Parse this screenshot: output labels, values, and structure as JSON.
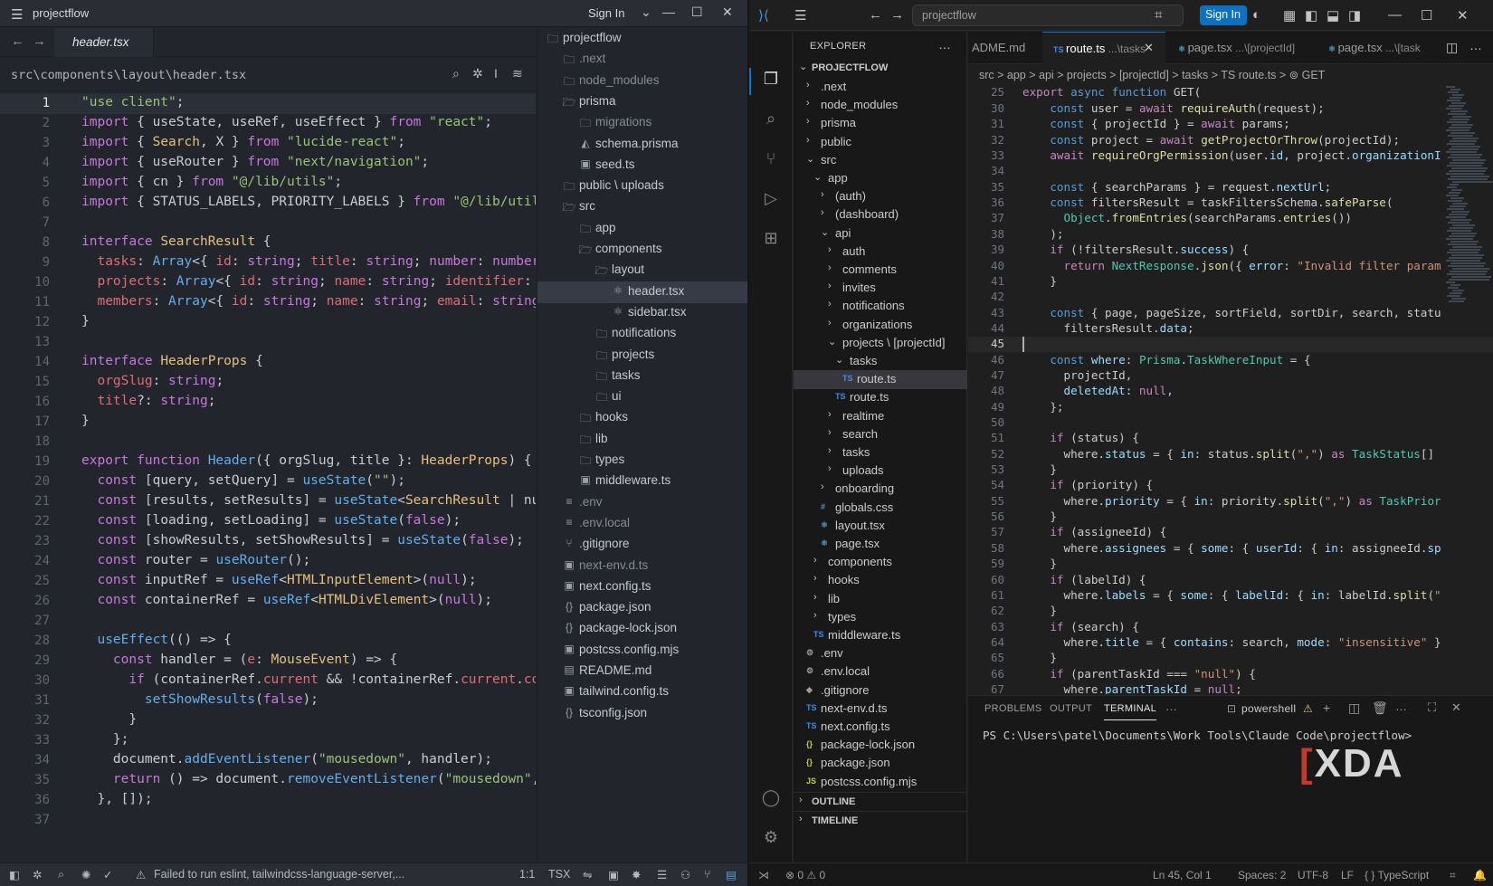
{
  "left": {
    "title": {
      "menu_icon": "hamburger-icon",
      "project": "projectflow",
      "sign_in": "Sign In"
    },
    "tab": {
      "label": "header.tsx"
    },
    "breadcrumb": "src\\components\\layout\\header.tsx",
    "status": {
      "message": "Failed to run eslint, tailwindcss-language-server,...",
      "position": "1:1",
      "language": "TSX"
    },
    "code_lines": [
      "\"use client\";",
      "import { useState, useRef, useEffect } from \"react\";",
      "import { Search, X } from \"lucide-react\";",
      "import { useRouter } from \"next/navigation\";",
      "import { cn } from \"@/lib/utils\";",
      "import { STATUS_LABELS, PRIORITY_LABELS } from \"@/lib/util",
      "",
      "interface SearchResult {",
      "  tasks: Array<{ id: string; title: string; number: number",
      "  projects: Array<{ id: string; name: string; identifier:",
      "  members: Array<{ id: string; name: string; email: string",
      "}",
      "",
      "interface HeaderProps {",
      "  orgSlug: string;",
      "  title?: string;",
      "}",
      "",
      "export function Header({ orgSlug, title }: HeaderProps) {",
      "  const [query, setQuery] = useState(\"\");",
      "  const [results, setResults] = useState<SearchResult | nu",
      "  const [loading, setLoading] = useState(false);",
      "  const [showResults, setShowResults] = useState(false);",
      "  const router = useRouter();",
      "  const inputRef = useRef<HTMLInputElement>(null);",
      "  const containerRef = useRef<HTMLDivElement>(null);",
      "",
      "  useEffect(() => {",
      "    const handler = (e: MouseEvent) => {",
      "      if (containerRef.current && !containerRef.current.co",
      "        setShowResults(false);",
      "      }",
      "    };",
      "    document.addEventListener(\"mousedown\", handler);",
      "    return () => document.removeEventListener(\"mousedown\",",
      "  }, []);",
      ""
    ],
    "tree": [
      {
        "name": "projectflow",
        "type": "folder"
      },
      {
        "name": ".next",
        "type": "folder",
        "dim": true
      },
      {
        "name": "node_modules",
        "type": "folder",
        "dim": true
      },
      {
        "name": "prisma",
        "type": "folder-open"
      },
      {
        "name": "migrations",
        "type": "folder",
        "dim": true
      },
      {
        "name": "schema.prisma",
        "type": "prisma"
      },
      {
        "name": "seed.ts",
        "type": "ts"
      },
      {
        "name": "public \\ uploads",
        "type": "folder"
      },
      {
        "name": "src",
        "type": "folder-open"
      },
      {
        "name": "app",
        "type": "folder"
      },
      {
        "name": "components",
        "type": "folder-open"
      },
      {
        "name": "layout",
        "type": "folder-open"
      },
      {
        "name": "header.tsx",
        "type": "react",
        "selected": true
      },
      {
        "name": "sidebar.tsx",
        "type": "react"
      },
      {
        "name": "notifications",
        "type": "folder"
      },
      {
        "name": "projects",
        "type": "folder"
      },
      {
        "name": "tasks",
        "type": "folder"
      },
      {
        "name": "ui",
        "type": "folder"
      },
      {
        "name": "hooks",
        "type": "folder"
      },
      {
        "name": "lib",
        "type": "folder"
      },
      {
        "name": "types",
        "type": "folder"
      },
      {
        "name": "middleware.ts",
        "type": "ts"
      },
      {
        "name": ".env",
        "type": "env",
        "dim": true
      },
      {
        "name": ".env.local",
        "type": "env",
        "dim": true
      },
      {
        "name": ".gitignore",
        "type": "git"
      },
      {
        "name": "next-env.d.ts",
        "type": "ts",
        "dim": true
      },
      {
        "name": "next.config.ts",
        "type": "ts"
      },
      {
        "name": "package.json",
        "type": "json"
      },
      {
        "name": "package-lock.json",
        "type": "json"
      },
      {
        "name": "postcss.config.mjs",
        "type": "js"
      },
      {
        "name": "README.md",
        "type": "md"
      },
      {
        "name": "tailwind.config.ts",
        "type": "ts"
      },
      {
        "name": "tsconfig.json",
        "type": "json"
      }
    ]
  },
  "right": {
    "title": {
      "search": "projectflow",
      "sign_in": "Sign In"
    },
    "explorer": {
      "header": "EXPLORER",
      "root": "PROJECTFLOW",
      "outline": "OUTLINE",
      "timeline": "TIMELINE"
    },
    "tabs": [
      {
        "label": "ADME.md",
        "dir": ""
      },
      {
        "label": "route.ts",
        "dir": " ...\\tasks",
        "active": true
      },
      {
        "label": "page.tsx",
        "dir": " ...\\[projectId]"
      },
      {
        "label": "page.tsx",
        "dir": " ...\\[task"
      }
    ],
    "breadcrumb": "src > app > api > projects > [projectId] > tasks > TS route.ts > ⊚ GET",
    "tree": [
      {
        "name": ".next",
        "depth": 0,
        "chev": "›"
      },
      {
        "name": "node_modules",
        "depth": 0,
        "chev": "›"
      },
      {
        "name": "prisma",
        "depth": 0,
        "chev": "›"
      },
      {
        "name": "public",
        "depth": 0,
        "chev": "›"
      },
      {
        "name": "src",
        "depth": 0,
        "chev": "⌄"
      },
      {
        "name": "app",
        "depth": 1,
        "chev": "⌄"
      },
      {
        "name": "(auth)",
        "depth": 2,
        "chev": "›"
      },
      {
        "name": "(dashboard)",
        "depth": 2,
        "chev": "›"
      },
      {
        "name": "api",
        "depth": 2,
        "chev": "⌄"
      },
      {
        "name": "auth",
        "depth": 3,
        "chev": "›"
      },
      {
        "name": "comments",
        "depth": 3,
        "chev": "›"
      },
      {
        "name": "invites",
        "depth": 3,
        "chev": "›"
      },
      {
        "name": "notifications",
        "depth": 3,
        "chev": "›"
      },
      {
        "name": "organizations",
        "depth": 3,
        "chev": "›"
      },
      {
        "name": "projects \\ [projectId]",
        "depth": 3,
        "chev": "⌄"
      },
      {
        "name": "tasks",
        "depth": 4,
        "chev": "⌄"
      },
      {
        "name": "route.ts",
        "depth": 5,
        "file": "TS",
        "selected": true
      },
      {
        "name": "route.ts",
        "depth": 4,
        "file": "TS"
      },
      {
        "name": "realtime",
        "depth": 3,
        "chev": "›"
      },
      {
        "name": "search",
        "depth": 3,
        "chev": "›"
      },
      {
        "name": "tasks",
        "depth": 3,
        "chev": "›"
      },
      {
        "name": "uploads",
        "depth": 3,
        "chev": "›"
      },
      {
        "name": "onboarding",
        "depth": 2,
        "chev": "›"
      },
      {
        "name": "globals.css",
        "depth": 2,
        "file": "#"
      },
      {
        "name": "layout.tsx",
        "depth": 2,
        "file": "⚛"
      },
      {
        "name": "page.tsx",
        "depth": 2,
        "file": "⚛"
      },
      {
        "name": "components",
        "depth": 1,
        "chev": "›"
      },
      {
        "name": "hooks",
        "depth": 1,
        "chev": "›"
      },
      {
        "name": "lib",
        "depth": 1,
        "chev": "›"
      },
      {
        "name": "types",
        "depth": 1,
        "chev": "›"
      },
      {
        "name": "middleware.ts",
        "depth": 1,
        "file": "TS"
      },
      {
        "name": ".env",
        "depth": 0,
        "file": "⚙"
      },
      {
        "name": ".env.local",
        "depth": 0,
        "file": "⚙"
      },
      {
        "name": ".gitignore",
        "depth": 0,
        "file": "◆"
      },
      {
        "name": "next-env.d.ts",
        "depth": 0,
        "file": "TS"
      },
      {
        "name": "next.config.ts",
        "depth": 0,
        "file": "TS"
      },
      {
        "name": "package-lock.json",
        "depth": 0,
        "file": "{}"
      },
      {
        "name": "package.json",
        "depth": 0,
        "file": "{}"
      },
      {
        "name": "postcss.config.mjs",
        "depth": 0,
        "file": "JS"
      }
    ],
    "code_start": 25,
    "code_lines": [
      "export async function GET(",
      "    const user = await requireAuth(request);",
      "    const { projectId } = await params;",
      "    const project = await getProjectOrThrow(projectId);",
      "    await requireOrgPermission(user.id, project.organizationI",
      "",
      "    const { searchParams } = request.nextUrl;",
      "    const filtersResult = taskFiltersSchema.safeParse(",
      "      Object.fromEntries(searchParams.entries())",
      "    );",
      "    if (!filtersResult.success) {",
      "      return NextResponse.json({ error: \"Invalid filter param",
      "    }",
      "",
      "    const { page, pageSize, sortField, sortDir, search, statu",
      "      filtersResult.data;",
      "",
      "    const where: Prisma.TaskWhereInput = {",
      "      projectId,",
      "      deletedAt: null,",
      "    };",
      "",
      "    if (status) {",
      "      where.status = { in: status.split(\",\") as TaskStatus[]",
      "    }",
      "    if (priority) {",
      "      where.priority = { in: priority.split(\",\") as TaskPrior",
      "    }",
      "    if (assigneeId) {",
      "      where.assignees = { some: { userId: { in: assigneeId.sp",
      "    }",
      "    if (labelId) {",
      "      where.labels = { some: { labelId: { in: labelId.split(\"",
      "    }",
      "    if (search) {",
      "      where.title = { contains: search, mode: \"insensitive\" }",
      "    }",
      "    if (parentTaskId === \"null\") {",
      "      where.parentTaskId = null;"
    ],
    "code_numbers": [
      25,
      30,
      31,
      32,
      33,
      34,
      35,
      36,
      37,
      38,
      39,
      40,
      41,
      42,
      43,
      44,
      45,
      46,
      47,
      48,
      49,
      50,
      51,
      52,
      53,
      54,
      55,
      56,
      57,
      58,
      59,
      60,
      61,
      62,
      63,
      64,
      65,
      66,
      67
    ],
    "panel": {
      "tabs": [
        "PROBLEMS",
        "OUTPUT",
        "TERMINAL"
      ],
      "shell": "powershell",
      "command": "PS C:\\Users\\patel\\Documents\\Work Tools\\Claude Code\\projectflow>",
      "watermark": "XDA"
    },
    "status": {
      "problems": "⊗ 0 ⚠ 0",
      "position": "Ln 45, Col 1",
      "spaces": "Spaces: 2",
      "encoding": "UTF-8",
      "eol": "LF",
      "language": "{ } TypeScript"
    }
  }
}
